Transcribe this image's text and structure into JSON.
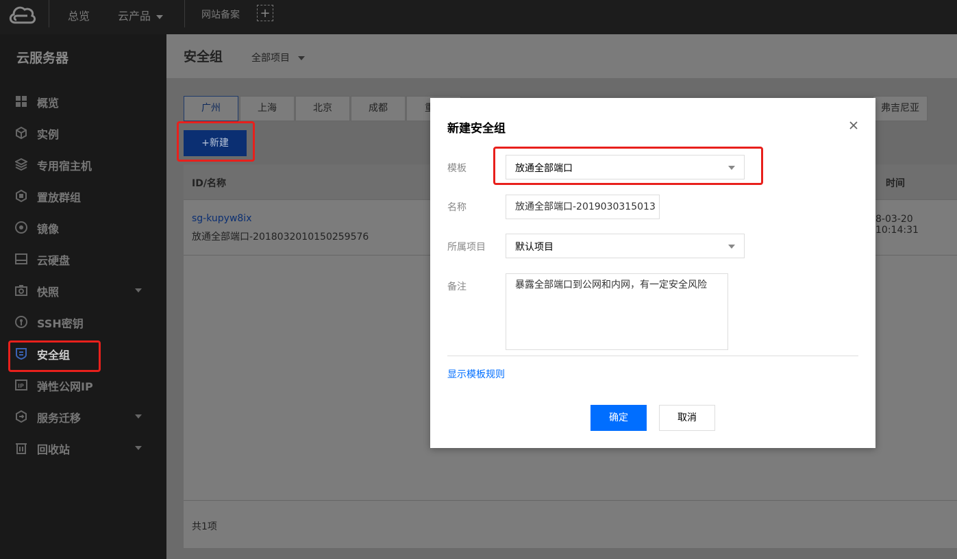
{
  "topbar": {
    "nav": [
      {
        "label": "总览"
      },
      {
        "label": "云产品"
      },
      {
        "label": "网站备案"
      }
    ],
    "add_symbol": "+"
  },
  "sidebar": {
    "title": "云服务器",
    "items": [
      {
        "label": "概览",
        "icon": "grid-icon"
      },
      {
        "label": "实例",
        "icon": "cube-icon"
      },
      {
        "label": "专用宿主机",
        "icon": "layers-icon"
      },
      {
        "label": "置放群组",
        "icon": "group-icon"
      },
      {
        "label": "镜像",
        "icon": "disc-icon"
      },
      {
        "label": "云硬盘",
        "icon": "disk-icon"
      },
      {
        "label": "快照",
        "icon": "camera-icon"
      },
      {
        "label": "SSH密钥",
        "icon": "key-icon"
      },
      {
        "label": "安全组",
        "icon": "shield-icon"
      },
      {
        "label": "弹性公网IP",
        "icon": "ip-icon"
      },
      {
        "label": "服务迁移",
        "icon": "migrate-icon"
      },
      {
        "label": "回收站",
        "icon": "trash-icon"
      }
    ],
    "active": "安全组"
  },
  "page": {
    "title": "安全组",
    "project_selector": "全部项目"
  },
  "region_tabs": [
    "广州",
    "上海",
    "北京",
    "成都",
    "重",
    "弗吉尼亚"
  ],
  "active_region": "广州",
  "new_button": "+新建",
  "table": {
    "columns": [
      "ID/名称",
      "时间"
    ],
    "rows": [
      {
        "id": "sg-kupyw8ix",
        "name": "放通全部端口-2018032010150259576",
        "time": "8-03-20 10:14:31"
      }
    ],
    "footer": "共1项"
  },
  "modal": {
    "title": "新建安全组",
    "fields": {
      "template_label": "模板",
      "template_value": "放通全部端口",
      "name_label": "名称",
      "name_value": "放通全部端口-2019030315013",
      "project_label": "所属项目",
      "project_value": "默认项目",
      "note_label": "备注",
      "note_value": "暴露全部端口到公网和内网，有一定安全风险"
    },
    "link": "显示模板规则",
    "confirm_button": "确定",
    "cancel_button": "取消"
  },
  "colors": {
    "accent": "#006eff",
    "highlight": "#e8201c"
  }
}
